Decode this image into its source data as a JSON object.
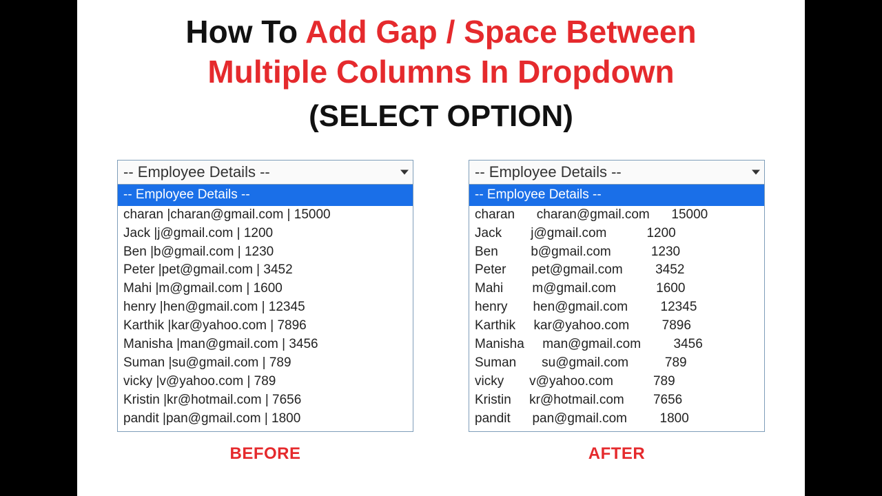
{
  "title": {
    "howto": "How To ",
    "redA": "Add Gap / Space Between",
    "redB": "Multiple Columns In Dropdown",
    "line3_open": "(",
    "line3_mid": "SELECT OPTION",
    "line3_close": ")"
  },
  "labels": {
    "before": "BEFORE",
    "after": "AFTER",
    "placeholder": "-- Employee Details --"
  },
  "employees": [
    {
      "name": "charan",
      "email": "charan@gmail.com",
      "sal": "15000"
    },
    {
      "name": "Jack",
      "email": "j@gmail.com",
      "sal": "1200"
    },
    {
      "name": "Ben",
      "email": "b@gmail.com",
      "sal": "1230"
    },
    {
      "name": "Peter",
      "email": "pet@gmail.com",
      "sal": "3452"
    },
    {
      "name": "Mahi",
      "email": "m@gmail.com",
      "sal": "1600"
    },
    {
      "name": "henry",
      "email": "hen@gmail.com",
      "sal": "12345"
    },
    {
      "name": "Karthik",
      "email": "kar@yahoo.com",
      "sal": "7896"
    },
    {
      "name": "Manisha",
      "email": "man@gmail.com",
      "sal": "3456"
    },
    {
      "name": "Suman",
      "email": "su@gmail.com",
      "sal": "789"
    },
    {
      "name": "vicky",
      "email": "v@yahoo.com",
      "sal": "789"
    },
    {
      "name": "Kristin",
      "email": "kr@hotmail.com",
      "sal": "7656"
    },
    {
      "name": "pandit",
      "email": "pan@gmail.com",
      "sal": "1800"
    }
  ]
}
